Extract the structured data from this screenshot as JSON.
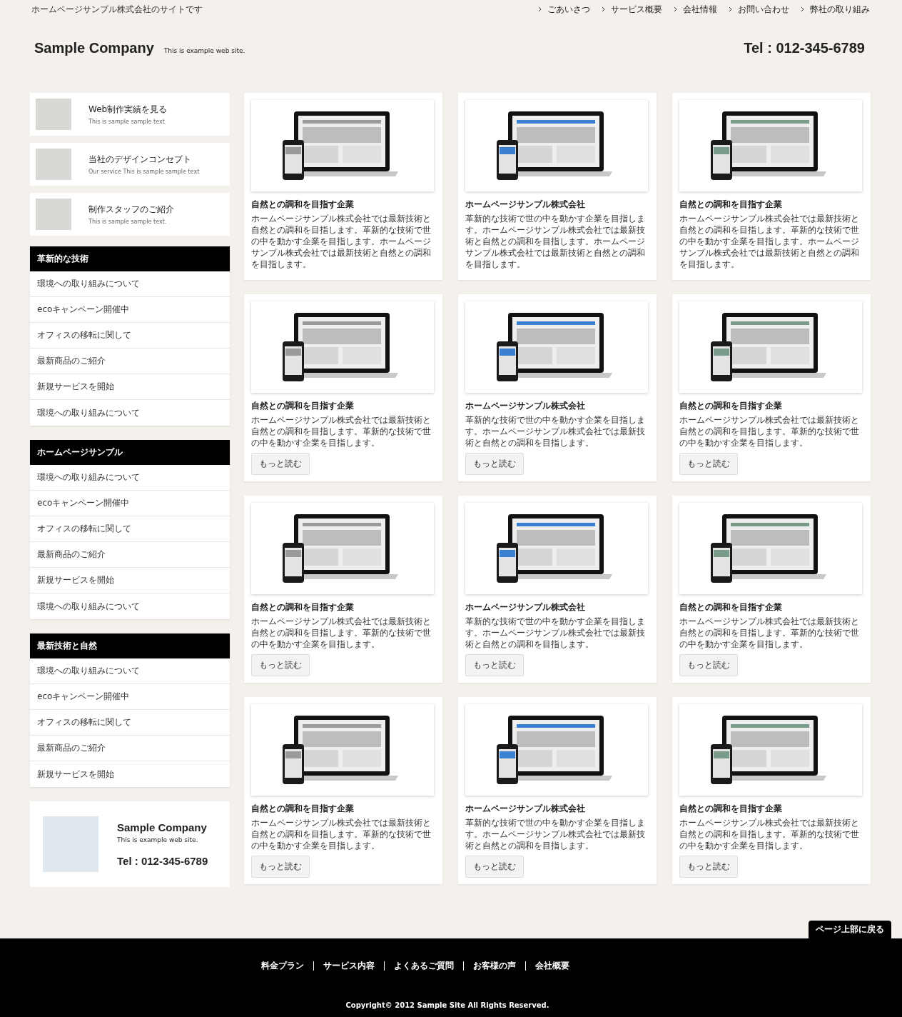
{
  "top_bar": {
    "tagline": "ホームページサンプル株式会社のサイトです",
    "nav": [
      "ごあいさつ",
      "サービス概要",
      "会社情報",
      "お問い合わせ",
      "弊社の取り組み"
    ]
  },
  "header": {
    "logo": "Sample Company",
    "subtitle": "This is example web site.",
    "tel": "Tel : 012-345-6789"
  },
  "sidebar": {
    "banners": [
      {
        "title": "Web制作実績を見る",
        "subtitle": "This is sample sample text"
      },
      {
        "title": "当社のデザインコンセプト",
        "subtitle": "Our service This is sample sample text"
      },
      {
        "title": "制作スタッフのご紹介",
        "subtitle": "This is sample sample text."
      }
    ],
    "menus": [
      {
        "heading": "革新的な技術",
        "items": [
          "環境への取り組みについて",
          "ecoキャンペーン開催中",
          "オフィスの移転に関して",
          "最新商品のご紹介",
          "新規サービスを開始",
          "環境への取り組みについて"
        ]
      },
      {
        "heading": "ホームページサンプル",
        "items": [
          "環境への取り組みについて",
          "ecoキャンペーン開催中",
          "オフィスの移転に関して",
          "最新商品のご紹介",
          "新規サービスを開始",
          "環境への取り組みについて"
        ]
      },
      {
        "heading": "最新技術と自然",
        "items": [
          "環境への取り組みについて",
          "ecoキャンペーン開催中",
          "オフィスの移転に関して",
          "最新商品のご紹介",
          "新規サービスを開始"
        ]
      }
    ],
    "company_card": {
      "name": "Sample Company",
      "subtitle": "This is example web site.",
      "tel": "Tel : 012-345-6789"
    }
  },
  "cards": [
    {
      "title": "自然との調和を目指す企業",
      "text": "ホームページサンプル株式会社では最新技術と自然との調和を目指します。革新的な技術で世の中を動かす企業を目指します。ホームページサンプル株式会社では最新技術と自然との調和を目指します。"
    },
    {
      "title": "ホームページサンプル株式会社",
      "text": "革新的な技術で世の中を動かす企業を目指します。ホームページサンプル株式会社では最新技術と自然との調和を目指します。ホームページサンプル株式会社では最新技術と自然との調和を目指します。"
    },
    {
      "title": "自然との調和を目指す企業",
      "text": "ホームページサンプル株式会社では最新技術と自然との調和を目指します。革新的な技術で世の中を動かす企業を目指します。ホームページサンプル株式会社では最新技術と自然との調和を目指します。"
    },
    {
      "title": "自然との調和を目指す企業",
      "text": "ホームページサンプル株式会社では最新技術と自然との調和を目指します。革新的な技術で世の中を動かす企業を目指します。",
      "button": "もっと読む"
    },
    {
      "title": "ホームページサンプル株式会社",
      "text": "革新的な技術で世の中を動かす企業を目指します。ホームページサンプル株式会社では最新技術と自然との調和を目指します。",
      "button": "もっと読む"
    },
    {
      "title": "自然との調和を目指す企業",
      "text": "ホームページサンプル株式会社では最新技術と自然との調和を目指します。革新的な技術で世の中を動かす企業を目指します。",
      "button": "もっと読む"
    },
    {
      "title": "自然との調和を目指す企業",
      "text": "ホームページサンプル株式会社では最新技術と自然との調和を目指します。革新的な技術で世の中を動かす企業を目指します。",
      "button": "もっと読む"
    },
    {
      "title": "ホームページサンプル株式会社",
      "text": "革新的な技術で世の中を動かす企業を目指します。ホームページサンプル株式会社では最新技術と自然との調和を目指します。",
      "button": "もっと読む"
    },
    {
      "title": "自然との調和を目指す企業",
      "text": "ホームページサンプル株式会社では最新技術と自然との調和を目指します。革新的な技術で世の中を動かす企業を目指します。",
      "button": "もっと読む"
    },
    {
      "title": "自然との調和を目指す企業",
      "text": "ホームページサンプル株式会社では最新技術と自然との調和を目指します。革新的な技術で世の中を動かす企業を目指します。",
      "button": "もっと読む"
    },
    {
      "title": "ホームページサンプル株式会社",
      "text": "革新的な技術で世の中を動かす企業を目指します。ホームページサンプル株式会社では最新技術と自然との調和を目指します。",
      "button": "もっと読む"
    },
    {
      "title": "自然との調和を目指す企業",
      "text": "ホームページサンプル株式会社では最新技術と自然との調和を目指します。革新的な技術で世の中を動かす企業を目指します。",
      "button": "もっと読む"
    }
  ],
  "back_to_top": "ページ上部に戻る",
  "footer": {
    "links": [
      "料金プラン",
      "サービス内容",
      "よくあるご質問",
      "お客様の声",
      "会社概要"
    ],
    "copyright": "Copyright© 2012 Sample Site All Rights Reserved."
  }
}
